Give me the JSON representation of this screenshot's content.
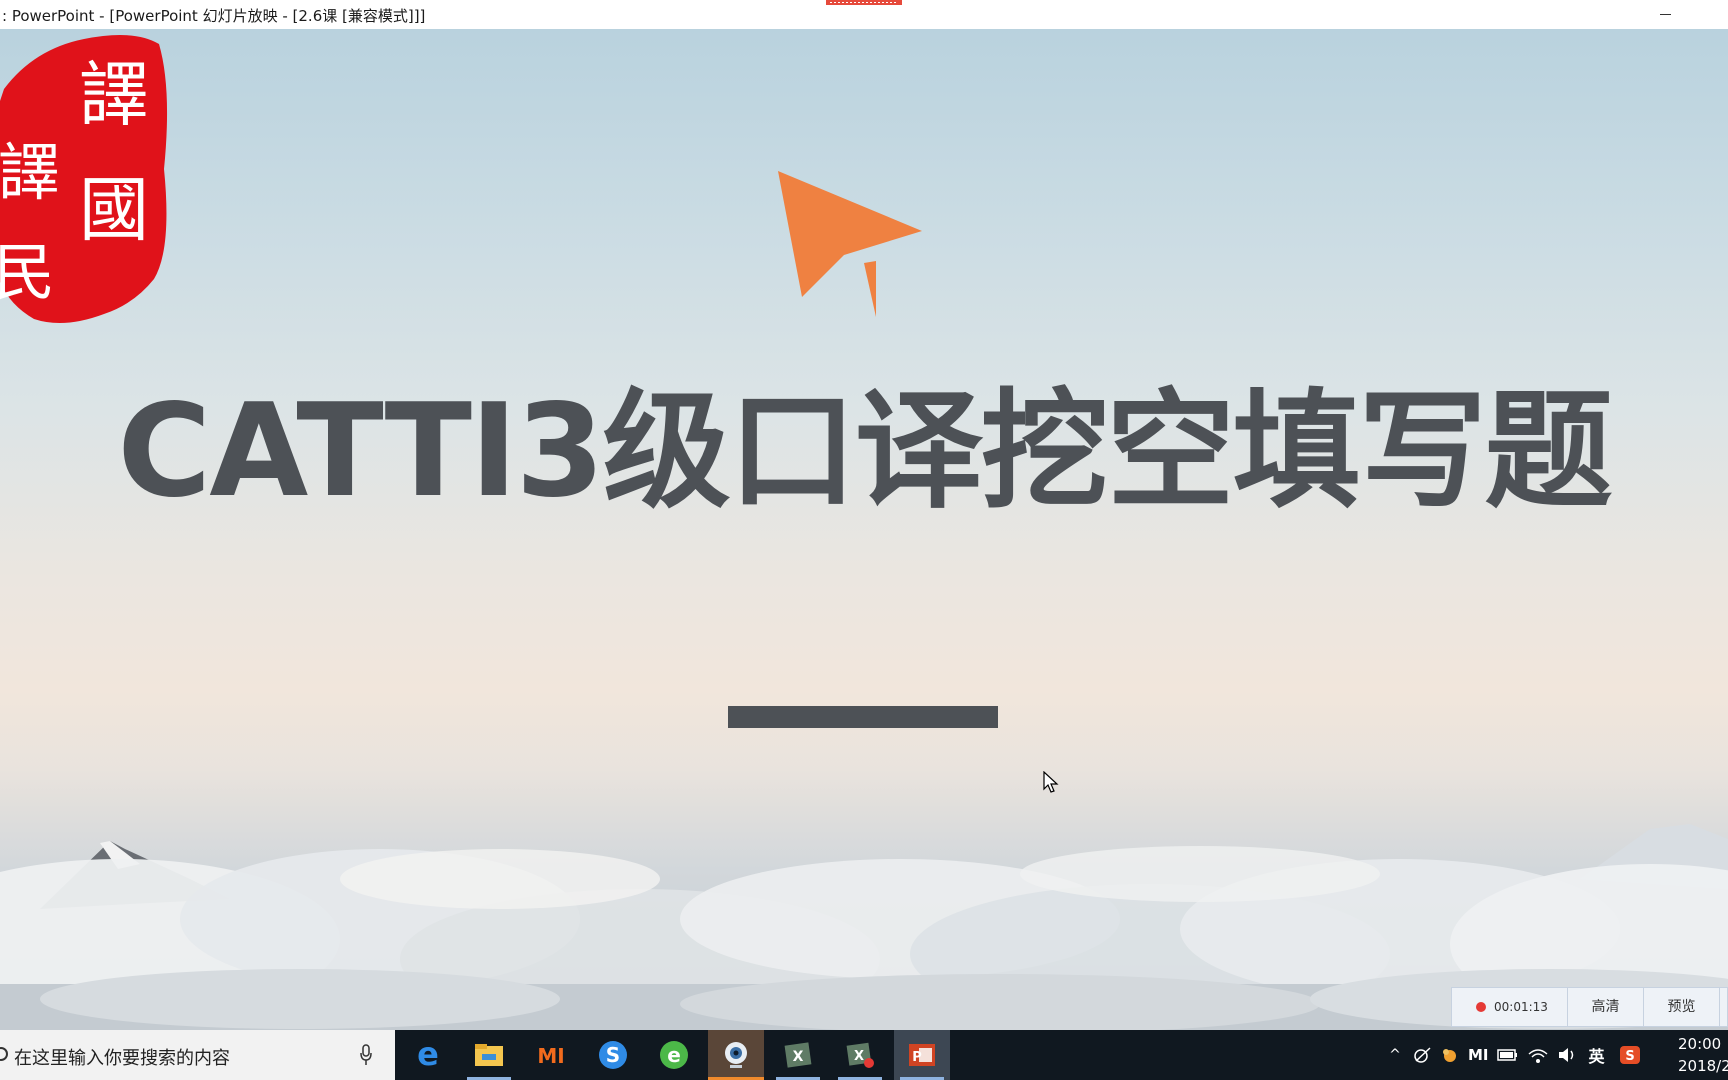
{
  "window": {
    "title": ": PowerPoint - [PowerPoint 幻灯片放映 - [2.6课 [兼容模式]]]"
  },
  "slide": {
    "title": "CATTI3级口译挖空填写题",
    "seal_chars": [
      "譯",
      "國",
      "譯",
      "民"
    ],
    "colors": {
      "title": "#4d5156",
      "plane": "#ef8141",
      "seal": "#e0121a"
    }
  },
  "recorder": {
    "time": "00:01:13",
    "quality_label": "高清",
    "preview_label": "预览"
  },
  "taskbar": {
    "search_placeholder": "在这里输入你要搜索的内容",
    "apps": [
      "edge-icon",
      "file-explorer-icon",
      "mi-icon",
      "sogou-browser-icon",
      "ie-browser-icon",
      "webcam-icon",
      "excel-icon",
      "excel-record-icon",
      "powerpoint-icon"
    ],
    "tray": {
      "ime_label": "英",
      "mi_label": "MI"
    },
    "clock": {
      "time": "20:00",
      "date": "2018/2"
    }
  }
}
